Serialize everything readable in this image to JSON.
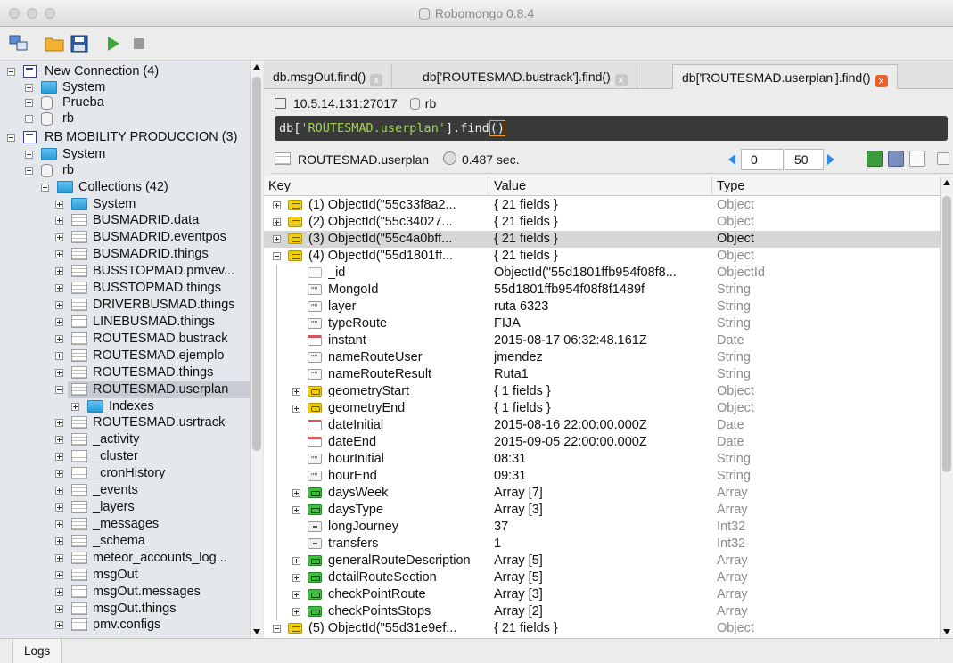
{
  "window": {
    "title": "Robomongo 0.8.4"
  },
  "toolbar": {
    "buttons": [
      "connect-icon",
      "open-icon",
      "save-icon",
      "execute-icon",
      "stop-icon"
    ]
  },
  "tree": [
    {
      "label": "New Connection (4)",
      "icon": "server",
      "expander": "minus"
    },
    {
      "label": "System",
      "icon": "folder",
      "expander": "plus"
    },
    {
      "label": "Prueba",
      "icon": "db",
      "expander": "plus"
    },
    {
      "label": "rb",
      "icon": "db",
      "expander": "plus"
    },
    {
      "label": "RB MOBILITY PRODUCCION (3)",
      "icon": "server",
      "expander": "minus"
    },
    {
      "label": "System",
      "icon": "folder",
      "expander": "plus"
    },
    {
      "label": "rb",
      "icon": "db",
      "expander": "minus"
    },
    {
      "label": "Collections (42)",
      "icon": "folder",
      "expander": "minus"
    },
    {
      "label": "System",
      "icon": "folder",
      "expander": "plus"
    },
    {
      "label": "BUSMADRID.data",
      "icon": "coll",
      "expander": "plus"
    },
    {
      "label": "BUSMADRID.eventpos",
      "icon": "coll",
      "expander": "plus"
    },
    {
      "label": "BUSMADRID.things",
      "icon": "coll",
      "expander": "plus"
    },
    {
      "label": "BUSSTOPMAD.pmvev...",
      "icon": "coll",
      "expander": "plus"
    },
    {
      "label": "BUSSTOPMAD.things",
      "icon": "coll",
      "expander": "plus"
    },
    {
      "label": "DRIVERBUSMAD.things",
      "icon": "coll",
      "expander": "plus"
    },
    {
      "label": "LINEBUSMAD.things",
      "icon": "coll",
      "expander": "plus"
    },
    {
      "label": "ROUTESMAD.bustrack",
      "icon": "coll",
      "expander": "plus"
    },
    {
      "label": "ROUTESMAD.ejemplo",
      "icon": "coll",
      "expander": "plus"
    },
    {
      "label": "ROUTESMAD.things",
      "icon": "coll",
      "expander": "plus"
    },
    {
      "label": "ROUTESMAD.userplan",
      "icon": "coll",
      "expander": "minus",
      "selected": true
    },
    {
      "label": "Indexes",
      "icon": "folder",
      "expander": "plus"
    },
    {
      "label": "ROUTESMAD.usrtrack",
      "icon": "coll",
      "expander": "plus"
    },
    {
      "label": "_activity",
      "icon": "coll",
      "expander": "plus"
    },
    {
      "label": "_cluster",
      "icon": "coll",
      "expander": "plus"
    },
    {
      "label": "_cronHistory",
      "icon": "coll",
      "expander": "plus"
    },
    {
      "label": "_events",
      "icon": "coll",
      "expander": "plus"
    },
    {
      "label": "_layers",
      "icon": "coll",
      "expander": "plus"
    },
    {
      "label": "_messages",
      "icon": "coll",
      "expander": "plus"
    },
    {
      "label": "_schema",
      "icon": "coll",
      "expander": "plus"
    },
    {
      "label": "meteor_accounts_log...",
      "icon": "coll",
      "expander": "plus"
    },
    {
      "label": "msgOut",
      "icon": "coll",
      "expander": "plus"
    },
    {
      "label": "msgOut.messages",
      "icon": "coll",
      "expander": "plus"
    },
    {
      "label": "msgOut.things",
      "icon": "coll",
      "expander": "plus"
    },
    {
      "label": "pmv.configs",
      "icon": "coll",
      "expander": "plus"
    }
  ],
  "tabs": [
    {
      "label": "db.msgOut.find()",
      "close": "x"
    },
    {
      "label": "db['ROUTESMAD.bustrack'].find()",
      "close": "x"
    },
    {
      "label": "db['ROUTESMAD.userplan'].find()",
      "close": "x",
      "active": true
    }
  ],
  "connection": {
    "server": "10.5.14.131:27017",
    "database": "rb"
  },
  "query": {
    "prefix": "db[",
    "collection": "'ROUTESMAD.userplan'",
    "mid": "].find",
    "paren": "()"
  },
  "result": {
    "collection": "ROUTESMAD.userplan",
    "time": "0.487 sec.",
    "skip": "0",
    "limit": "50"
  },
  "grid": {
    "columns": [
      "Key",
      "Value",
      "Type"
    ],
    "rows": [
      {
        "key": "(1) ObjectId(\"55c33f8a2...",
        "value": "{ 21 fields }",
        "type": "Object",
        "icon": "obj",
        "exp": "plus"
      },
      {
        "key": "(2) ObjectId(\"55c34027...",
        "value": "{ 21 fields }",
        "type": "Object",
        "icon": "obj",
        "exp": "plus"
      },
      {
        "key": "(3) ObjectId(\"55c4a0bff...",
        "value": "{ 21 fields }",
        "type": "Object",
        "icon": "obj",
        "exp": "plus",
        "highlight": true
      },
      {
        "key": "(4) ObjectId(\"55d1801ff...",
        "value": "{ 21 fields }",
        "type": "Object",
        "icon": "obj",
        "exp": "minus"
      },
      {
        "key": "_id",
        "value": "ObjectId(\"55d1801ffb954f08f8...",
        "type": "ObjectId",
        "icon": "oid",
        "child": true
      },
      {
        "key": "MongoId",
        "value": "55d1801ffb954f08f8f1489f",
        "type": "String",
        "icon": "str",
        "child": true
      },
      {
        "key": "layer",
        "value": "ruta 6323",
        "type": "String",
        "icon": "str",
        "child": true
      },
      {
        "key": "typeRoute",
        "value": "FIJA",
        "type": "String",
        "icon": "str",
        "child": true
      },
      {
        "key": "instant",
        "value": "2015-08-17 06:32:48.161Z",
        "type": "Date",
        "icon": "date",
        "child": true
      },
      {
        "key": "nameRouteUser",
        "value": "jmendez",
        "type": "String",
        "icon": "str",
        "child": true
      },
      {
        "key": "nameRouteResult",
        "value": "Ruta1",
        "type": "String",
        "icon": "str",
        "child": true
      },
      {
        "key": "geometryStart",
        "value": "{ 1 fields }",
        "type": "Object",
        "icon": "obj",
        "child": true,
        "exp": "plus"
      },
      {
        "key": "geometryEnd",
        "value": "{ 1 fields }",
        "type": "Object",
        "icon": "obj",
        "child": true,
        "exp": "plus"
      },
      {
        "key": "dateInitial",
        "value": "2015-08-16 22:00:00.000Z",
        "type": "Date",
        "icon": "date",
        "child": true
      },
      {
        "key": "dateEnd",
        "value": "2015-09-05 22:00:00.000Z",
        "type": "Date",
        "icon": "date",
        "child": true
      },
      {
        "key": "hourInitial",
        "value": "08:31",
        "type": "String",
        "icon": "str",
        "child": true
      },
      {
        "key": "hourEnd",
        "value": "09:31",
        "type": "String",
        "icon": "str",
        "child": true
      },
      {
        "key": "daysWeek",
        "value": "Array [7]",
        "type": "Array",
        "icon": "arr",
        "child": true,
        "exp": "plus"
      },
      {
        "key": "daysType",
        "value": "Array [3]",
        "type": "Array",
        "icon": "arr",
        "child": true,
        "exp": "plus"
      },
      {
        "key": "longJourney",
        "value": "37",
        "type": "Int32",
        "icon": "num",
        "child": true
      },
      {
        "key": "transfers",
        "value": "1",
        "type": "Int32",
        "icon": "num",
        "child": true
      },
      {
        "key": "generalRouteDescription",
        "value": "Array [5]",
        "type": "Array",
        "icon": "arr",
        "child": true,
        "exp": "plus"
      },
      {
        "key": "detailRouteSection",
        "value": "Array [5]",
        "type": "Array",
        "icon": "arr",
        "child": true,
        "exp": "plus"
      },
      {
        "key": "checkPointRoute",
        "value": "Array [3]",
        "type": "Array",
        "icon": "arr",
        "child": true,
        "exp": "plus"
      },
      {
        "key": "checkPointsStops",
        "value": "Array [2]",
        "type": "Array",
        "icon": "arr",
        "child": true,
        "exp": "plus"
      },
      {
        "key": "(5) ObjectId(\"55d31e9ef...",
        "value": "{ 21 fields }",
        "type": "Object",
        "icon": "obj",
        "exp": "minus"
      }
    ]
  },
  "bottom": {
    "logs_label": "Logs"
  },
  "colors": {
    "query_bg": "#3a3a3a",
    "query_string": "#9fd64a",
    "close_active": "#e8602c",
    "pager_arrow": "#2d8ae8"
  }
}
